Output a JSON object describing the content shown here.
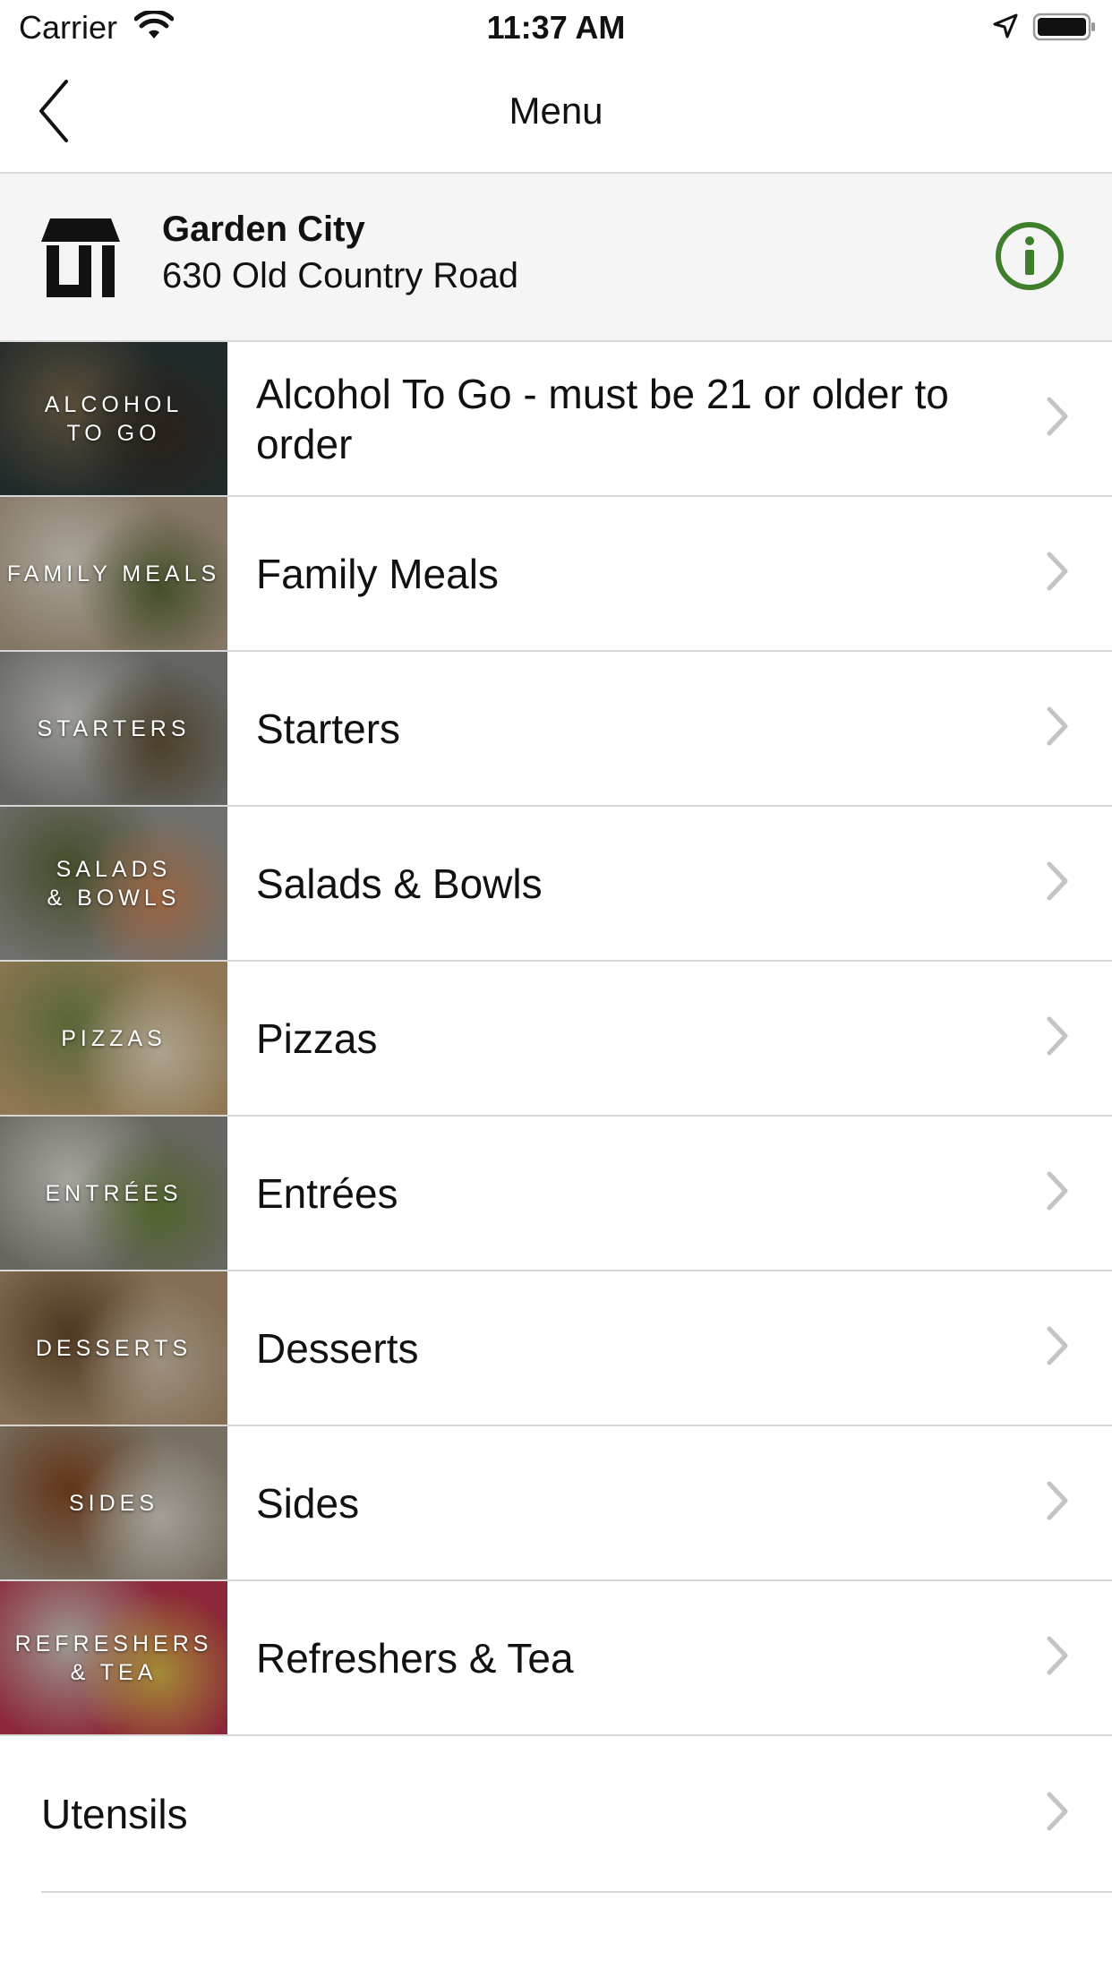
{
  "status_bar": {
    "carrier": "Carrier",
    "time": "11:37 AM"
  },
  "nav": {
    "title": "Menu",
    "back_icon": "chevron-left-icon"
  },
  "store": {
    "name": "Garden City",
    "address": "630 Old Country Road",
    "info_color": "#3f7e2b",
    "store_icon": "storefront-icon"
  },
  "menu": {
    "items": [
      {
        "label": "Alcohol To Go - must be 21 or older to order",
        "thumb_text": "ALCOHOL\nTO GO",
        "thumb_colors": [
          "#2c3a3a",
          "#7b6a4e",
          "#3b2e25"
        ]
      },
      {
        "label": "Family Meals",
        "thumb_text": "FAMILY MEALS",
        "thumb_colors": [
          "#b8a58c",
          "#e9e2d2",
          "#5f6e3a"
        ]
      },
      {
        "label": "Starters",
        "thumb_text": "STARTERS",
        "thumb_colors": [
          "#8a8a86",
          "#d8d6d0",
          "#6a5a3a"
        ]
      },
      {
        "label": "Salads & Bowls",
        "thumb_text": "SALADS\n& BOWLS",
        "thumb_colors": [
          "#9a9a94",
          "#5e6b3a",
          "#d48a5a"
        ]
      },
      {
        "label": "Pizzas",
        "thumb_text": "PIZZAS",
        "thumb_colors": [
          "#c9a574",
          "#7a8f4f",
          "#efe2c4"
        ]
      },
      {
        "label": "Entrées",
        "thumb_text": "ENTRÉES",
        "thumb_colors": [
          "#8f8d86",
          "#e4e1d8",
          "#6f8a3c"
        ]
      },
      {
        "label": "Desserts",
        "thumb_text": "DESSERTS",
        "thumb_colors": [
          "#b89873",
          "#6e4e2e",
          "#d8c7ad"
        ]
      },
      {
        "label": "Sides",
        "thumb_text": "SIDES",
        "thumb_colors": [
          "#a59a86",
          "#8a4a22",
          "#e2ddd2"
        ]
      },
      {
        "label": "Refreshers & Tea",
        "thumb_text": "REFRESHERS\n& TEA",
        "thumb_colors": [
          "#c2384f",
          "#d8d3c8",
          "#e3c04a"
        ]
      }
    ],
    "utensils_label": "Utensils"
  },
  "colors": {
    "divider": "#d7d7d7",
    "chevron": "#c4c4c6",
    "header_bg": "#f5f5f5"
  }
}
